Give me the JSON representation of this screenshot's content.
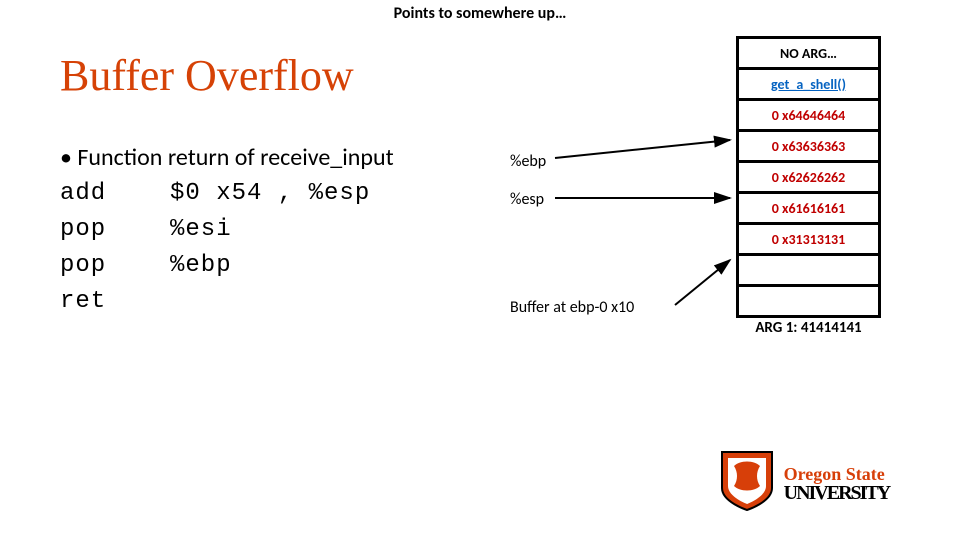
{
  "top_note": "Points to somewhere up…",
  "title": "Buffer Overflow",
  "bullet": "• Function return of receive_input",
  "code": {
    "l1a": "add",
    "l1b": "$0 x54 , %esp",
    "l2a": "pop",
    "l2b": "%esi",
    "l3a": "pop",
    "l3b": "%ebp",
    "l4a": "ret"
  },
  "pointers": {
    "ebp": "%ebp",
    "esp": "%esp",
    "buf": "Buffer at ebp-0 x10"
  },
  "stack": {
    "c0": "NO ARG…",
    "c1": "get_a_shell()",
    "c2": "0 x64646464",
    "c3": "0 x63636363",
    "c4": "0 x62626262",
    "c5": "0 x61616161",
    "c6": "0 x31313131",
    "arg": "ARG 1: 41414141"
  },
  "logo": {
    "line1": "Oregon State",
    "line2": "UNIVERSITY"
  }
}
